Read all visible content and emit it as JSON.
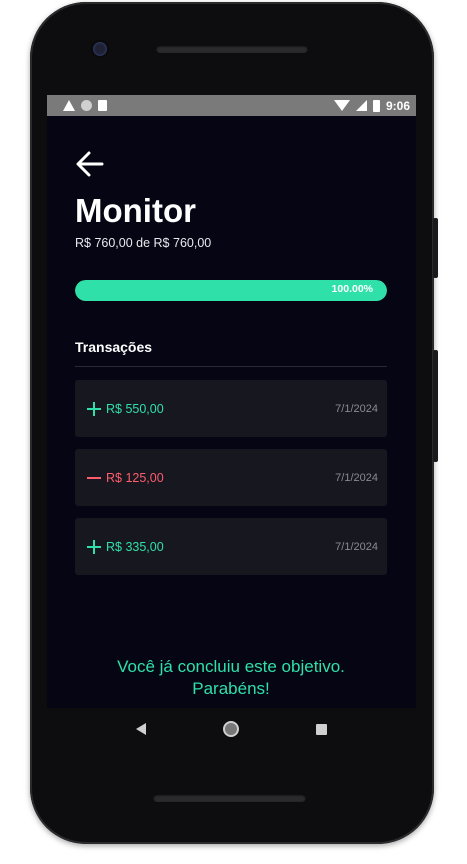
{
  "statusbar": {
    "time": "9:06",
    "icons": [
      "warning-icon",
      "circle-icon",
      "sd-card-icon",
      "wifi-icon",
      "signal-icon",
      "battery-icon"
    ]
  },
  "header": {
    "back_icon": "arrow-left-icon",
    "title": "Monitor",
    "subtitle": "R$ 760,00 de R$ 760,00"
  },
  "progress": {
    "value": 1.0,
    "label": "100.00%",
    "color": "#2fe0a8"
  },
  "transactions_section": {
    "title": "Transações",
    "items": [
      {
        "type": "credit",
        "amount": "R$ 550,00",
        "date": "7/1/2024"
      },
      {
        "type": "debit",
        "amount": "R$ 125,00",
        "date": "7/1/2024"
      },
      {
        "type": "credit",
        "amount": "R$ 335,00",
        "date": "7/1/2024"
      }
    ]
  },
  "completion": {
    "message_line1": "Você já concluiu este objetivo.",
    "message_line2": "Parabéns!"
  },
  "colors": {
    "background": "#050513",
    "accent": "#2fe0a8",
    "negative": "#ff5c6c",
    "card": "#17171f"
  }
}
